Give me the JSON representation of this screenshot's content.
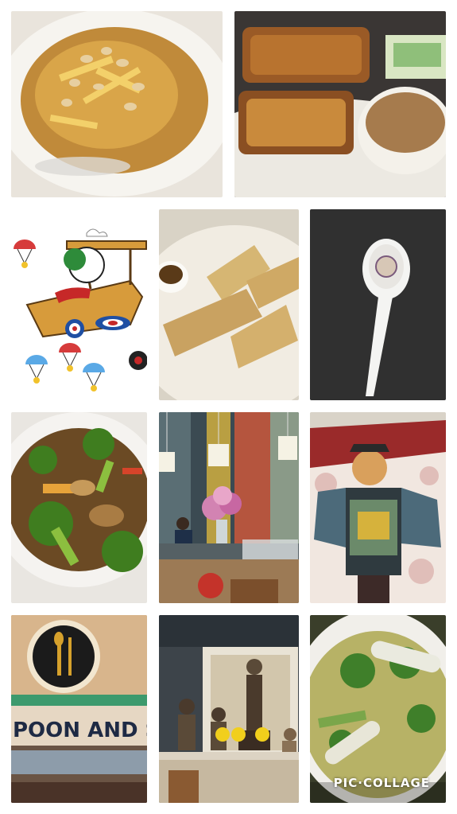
{
  "collage": {
    "watermark": "PIC·COLLAGE",
    "tiles": [
      {
        "id": "curry-bowl"
      },
      {
        "id": "satay-skewers"
      },
      {
        "id": "snoopy-biplane"
      },
      {
        "id": "fried-tofu"
      },
      {
        "id": "spoon-on-table"
      },
      {
        "id": "stir-fry-broccoli"
      },
      {
        "id": "restaurant-counter"
      },
      {
        "id": "samurai-mural"
      },
      {
        "id": "restaurant-sign"
      },
      {
        "id": "buddha-altar"
      },
      {
        "id": "vegetable-soup"
      }
    ],
    "sign": {
      "text": "POON AND SU"
    }
  }
}
